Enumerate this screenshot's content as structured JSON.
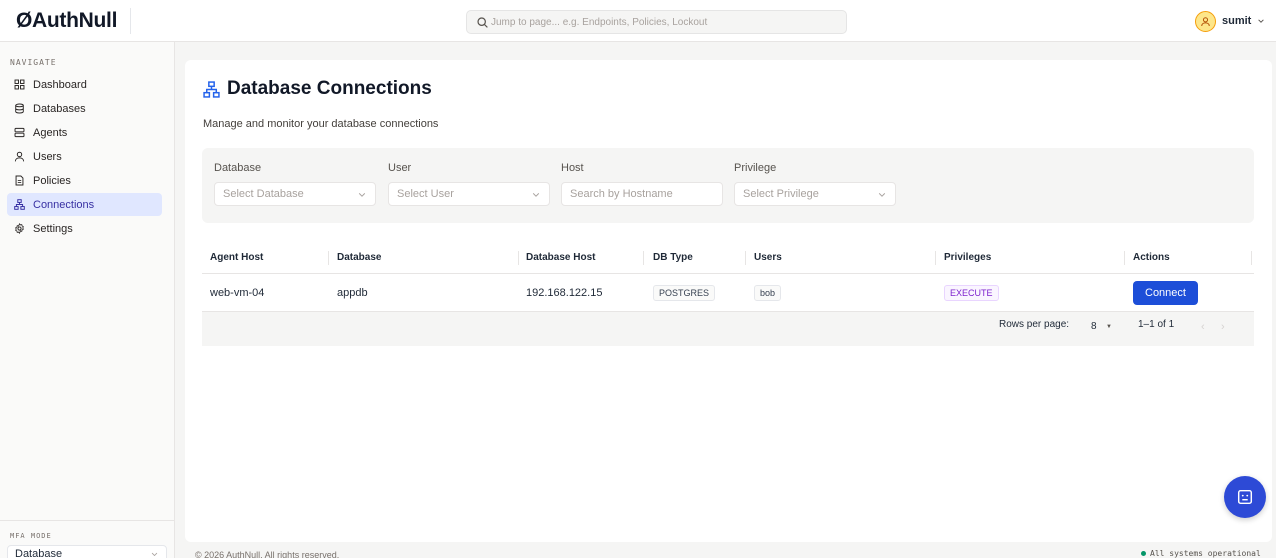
{
  "brand": {
    "logo": "ØAuthNull"
  },
  "search": {
    "placeholder": "Jump to page... e.g. Endpoints, Policies, Lockout"
  },
  "user": {
    "name": "sumit"
  },
  "sidebar": {
    "section_title": "NAVIGATE",
    "items": [
      {
        "label": "Dashboard",
        "icon": "grid-icon"
      },
      {
        "label": "Databases",
        "icon": "database-icon"
      },
      {
        "label": "Agents",
        "icon": "server-icon"
      },
      {
        "label": "Users",
        "icon": "user-icon"
      },
      {
        "label": "Policies",
        "icon": "document-icon"
      },
      {
        "label": "Connections",
        "icon": "network-icon",
        "active": true
      },
      {
        "label": "Settings",
        "icon": "gear-icon"
      }
    ],
    "mfa": {
      "label": "MFA MODE",
      "value": "Database"
    }
  },
  "page": {
    "title": "Database Connections",
    "subtitle": "Manage and monitor your database connections"
  },
  "filters": {
    "database": {
      "label": "Database",
      "placeholder": "Select Database"
    },
    "user": {
      "label": "User",
      "placeholder": "Select User"
    },
    "host": {
      "label": "Host",
      "placeholder": "Search by Hostname"
    },
    "privilege": {
      "label": "Privilege",
      "placeholder": "Select Privilege"
    }
  },
  "table": {
    "headers": [
      "Agent Host",
      "Database",
      "Database Host",
      "DB Type",
      "Users",
      "Privileges",
      "Actions"
    ],
    "rows": [
      {
        "agent_host": "web-vm-04",
        "database": "appdb",
        "database_host": "192.168.122.15",
        "db_type": "POSTGRES",
        "users": "bob",
        "privileges": "EXECUTE",
        "action": "Connect"
      }
    ],
    "footer": {
      "rows_per_page_label": "Rows per page:",
      "rows_per_page": "8",
      "range": "1–1 of 1",
      "prev": "‹",
      "next": "›"
    }
  },
  "footer": {
    "copyright": "© 2026 AuthNull. All rights reserved.",
    "status": "All systems operational",
    "status_color": "#059669"
  },
  "colors": {
    "accent": "#1d4ed8",
    "active_nav_bg": "#e0e7ff",
    "privilege_chip": "#7e22ce"
  }
}
